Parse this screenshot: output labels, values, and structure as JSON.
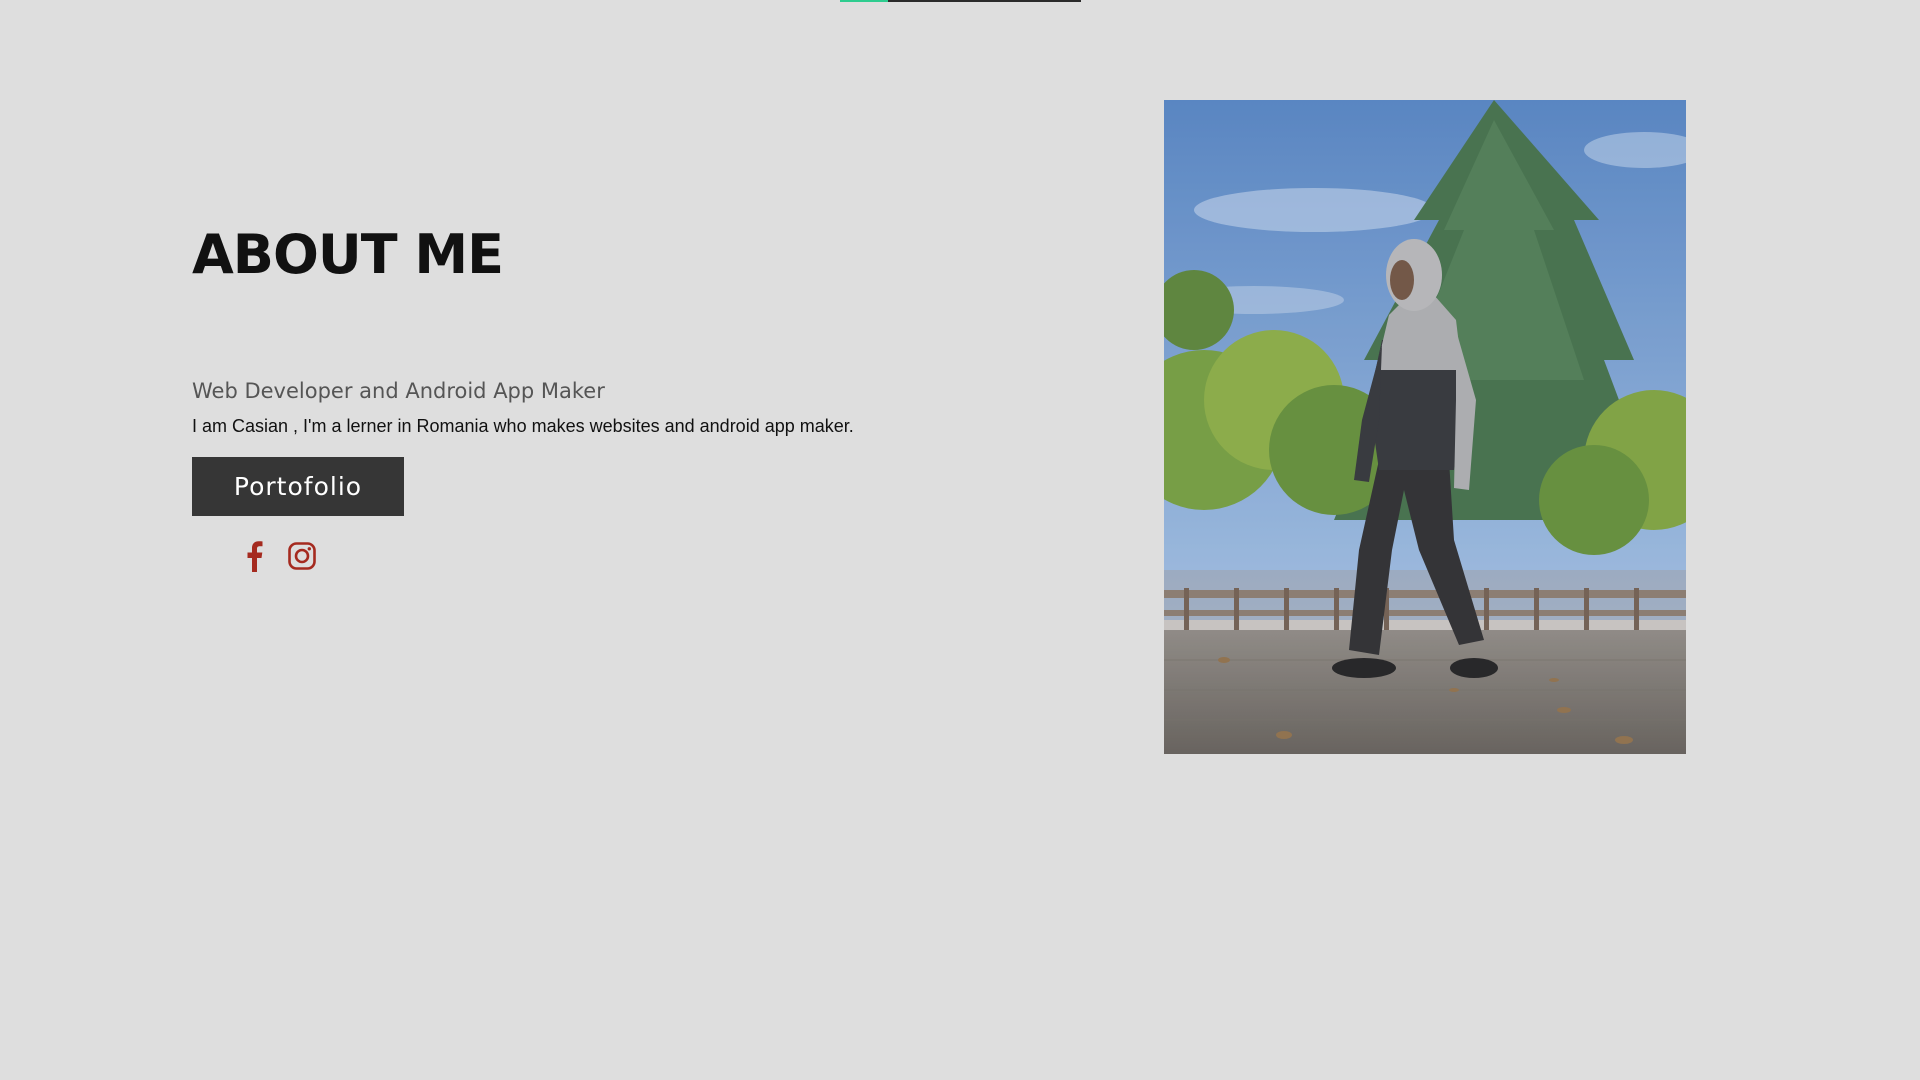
{
  "progress": {
    "fraction": 0.2,
    "accent_color": "#2ecc8f"
  },
  "about": {
    "title": "ABOUT ME",
    "subtitle": "Web Developer and Android App Maker",
    "description": "I am Casian , I'm a lerner in Romania who makes websites and android app maker.",
    "button_label": "Portofolio"
  },
  "socials": [
    {
      "icon": "facebook-icon",
      "color": "#a52a1f"
    },
    {
      "icon": "instagram-icon",
      "color": "#a52a1f"
    }
  ],
  "photo": {
    "icon": "profile-photo"
  }
}
